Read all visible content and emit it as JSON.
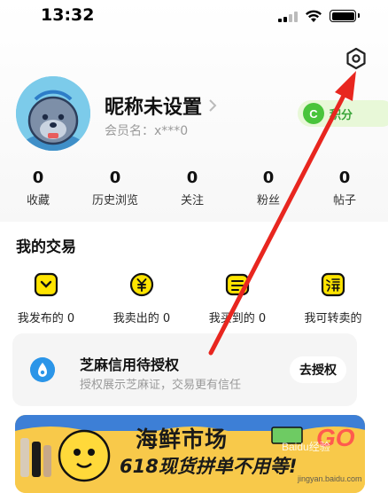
{
  "status_bar": {
    "time": "13:32"
  },
  "profile": {
    "nickname": "昵称未设置",
    "member_label": "会员名：x***0",
    "points_icon_letter": "C",
    "points_label": "积分"
  },
  "stats": [
    {
      "value": "0",
      "label": "收藏"
    },
    {
      "value": "0",
      "label": "历史浏览"
    },
    {
      "value": "0",
      "label": "关注"
    },
    {
      "value": "0",
      "label": "粉丝"
    },
    {
      "value": "0",
      "label": "帖子"
    }
  ],
  "trades": {
    "title": "我的交易",
    "items": [
      {
        "label": "我发布的 0",
        "icon": "publish-icon"
      },
      {
        "label": "我卖出的 0",
        "icon": "sold-icon"
      },
      {
        "label": "我买到的 0",
        "icon": "bought-icon"
      },
      {
        "label": "我可转卖的",
        "icon": "taobao-icon"
      }
    ]
  },
  "zhima": {
    "title": "芝麻信用待授权",
    "subtitle": "授权展示芝麻证，交易更有信任",
    "button": "去授权"
  },
  "banner": {
    "title": "海鲜市场",
    "subtitle": "618现货拼单不用等!",
    "go": "GO"
  },
  "watermark": {
    "brand": "Baidu经验",
    "url": "jingyan.baidu.com"
  },
  "colors": {
    "accent_yellow": "#ffe400",
    "points_green": "#49c43b",
    "annotation_red": "#e8261f",
    "zhima_blue": "#2b95e8"
  }
}
